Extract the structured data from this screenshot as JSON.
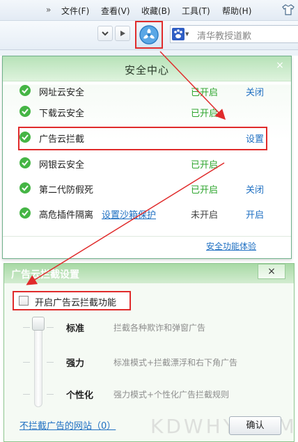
{
  "menu": {
    "chevron": "»",
    "items": [
      "文件(F)",
      "查看(V)",
      "收藏(B)",
      "工具(T)",
      "帮助(H)"
    ]
  },
  "toolbar": {
    "search_placeholder": "清华教授道歉"
  },
  "security_center": {
    "title": "安全中心",
    "close": "×",
    "rows": [
      {
        "name": "网址云安全",
        "status": "已开启",
        "action": "关闭"
      },
      {
        "name": "下载云安全",
        "status": "已开启",
        "action": ""
      },
      {
        "name": "广告云拦截",
        "status": "",
        "action": "设置"
      },
      {
        "name": "网银云安全",
        "status": "已开启",
        "action": ""
      },
      {
        "name": "第二代防假死",
        "status": "已开启",
        "action": "关闭"
      },
      {
        "name": "高危插件隔离",
        "sublink": "设置沙箱保护",
        "status": "未开启",
        "action": "开启"
      }
    ],
    "footer_link": "安全功能体验"
  },
  "ad_settings": {
    "title": "广告云拦截设置",
    "close": "×",
    "enable_label": "开启广告云拦截功能",
    "levels": [
      {
        "name": "标准",
        "desc": "拦截各种欺诈和弹窗广告"
      },
      {
        "name": "强力",
        "desc": "标准模式+拦截漂浮和右下角广告"
      },
      {
        "name": "个性化",
        "desc": "强力模式+个性化广告拦截规则"
      }
    ],
    "no_block_link": "不拦截广告的网站（0）",
    "ok_button": "确认"
  },
  "watermark": "KDWHY.COM",
  "colors": {
    "highlight": "#e02b2b",
    "status_on": "#2ea52e",
    "link": "#1e6fc2",
    "header_green": "#b7e2b8"
  }
}
